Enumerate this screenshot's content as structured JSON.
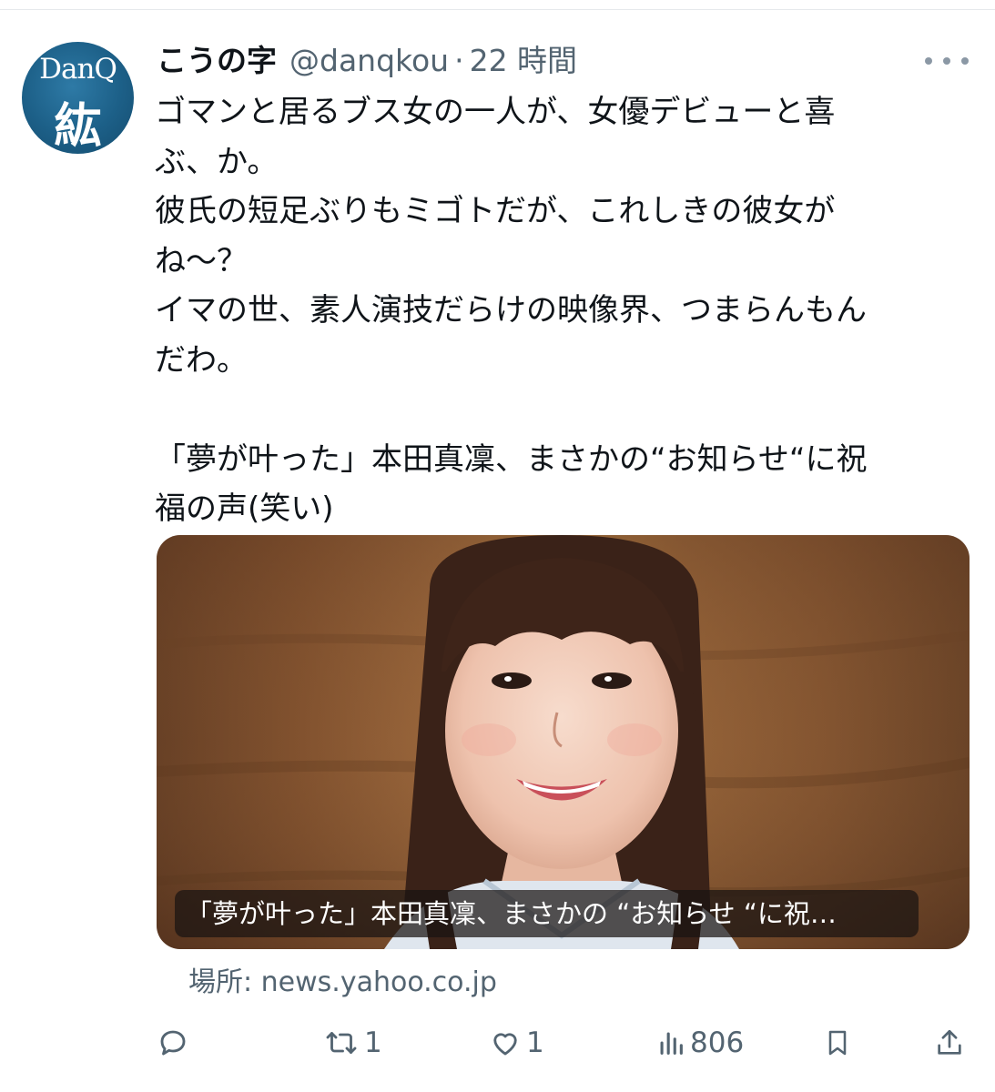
{
  "tweet": {
    "avatar": {
      "top_text": "DanQ",
      "bottom_text": "紘"
    },
    "display_name": "こうの字",
    "handle": "@danqkou",
    "separator": "·",
    "time": "22 時間",
    "text_lines": [
      "ゴマンと居るブス女の一人が、女優デビューと喜",
      "ぶ、か。",
      "彼氏の短足ぶりもミゴトだが、これしきの彼女が",
      "ね〜？",
      "イマの世、素人演技だらけの映像界、つまらんもん",
      "だわ。",
      "",
      "「夢が叶った」本田真凜、まさかの“お知らせ“に祝",
      "福の声(笑い)"
    ]
  },
  "link_card": {
    "caption": "「夢が叶った」本田真凜、まさかの “お知らせ “に祝…",
    "source_label": "場所: news.yahoo.co.jp"
  },
  "actions": {
    "reply_icon": "reply-icon",
    "retweet_icon": "retweet-icon",
    "retweet_count": "1",
    "like_icon": "heart-icon",
    "like_count": "1",
    "views_icon": "views-icon",
    "views_count": "806",
    "bookmark_icon": "bookmark-icon",
    "share_icon": "share-icon"
  },
  "colors": {
    "text": "#0f1419",
    "secondary": "#536471",
    "avatar_bg": "#1c5f87",
    "card_bg": "#8f5e36"
  }
}
